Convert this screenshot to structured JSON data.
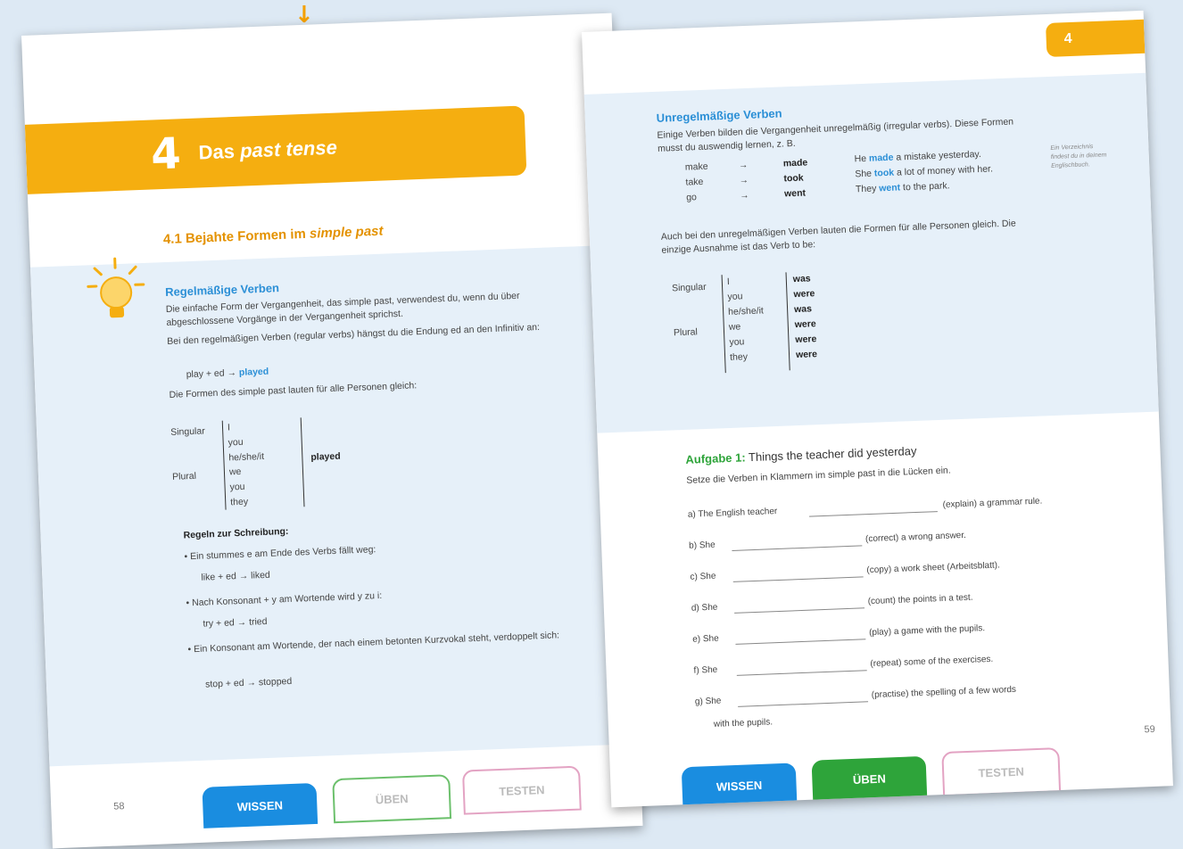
{
  "arrow": "↓",
  "left_page": {
    "chapter_number": "4",
    "chapter_title_pre": "Das ",
    "chapter_title_em": "past tense",
    "section": "4.1 Bejahte Formen im ",
    "section_em": "simple past",
    "sub_heading": "Regelmäßige Verben",
    "para1": "Die einfache Form der Vergangenheit, das simple past, verwendest du, wenn du über abgeschlossene Vorgänge in der Vergangenheit sprichst.",
    "para2": "Bei den regelmäßigen Verben (regular verbs) hängst du die Endung ed an den Infinitiv an:",
    "example1": "play + ed →",
    "example1_result": "played",
    "para3": "Die Formen des simple past lauten für alle Personen gleich:",
    "table": {
      "singular": "Singular",
      "plural": "Plural",
      "pronouns": [
        "I",
        "you",
        "he/she/it",
        "we",
        "you",
        "they"
      ],
      "form": "played"
    },
    "rules_heading": "Regeln zur Schreibung:",
    "rules": [
      {
        "text": "Ein stummes e am Ende des Verbs fällt weg:",
        "example": "like + ed → liked"
      },
      {
        "text": "Nach Konsonant + y am Wortende wird y zu i:",
        "example": "try + ed → tried"
      },
      {
        "text": "Ein Konsonant am Wortende, der nach einem betonten Kurzvokal steht, verdoppelt sich:",
        "example": "stop + ed → stopped"
      }
    ],
    "page_number": "58",
    "tabs": [
      "WISSEN",
      "ÜBEN",
      "TESTEN"
    ]
  },
  "right_page": {
    "corner_number": "4",
    "sub_heading": "Unregelmäßige Verben",
    "para1": "Einige Verben bilden die Vergangenheit unregelmäßig (irregular verbs). Diese Formen musst du auswendig lernen, z. B.",
    "irregular": [
      {
        "inf": "make",
        "past": "made",
        "sentence_pre": "He ",
        "sentence_verb": "made",
        "sentence_post": " a mistake yesterday."
      },
      {
        "inf": "take",
        "past": "took",
        "sentence_pre": "She ",
        "sentence_verb": "took",
        "sentence_post": " a lot of money with her."
      },
      {
        "inf": "go",
        "past": "went",
        "sentence_pre": "They ",
        "sentence_verb": "went",
        "sentence_post": " to the park."
      }
    ],
    "margin_note": "Ein Verzeichnis findest du in deinem Englischbuch.",
    "para2": "Auch bei den unregelmäßigen Verben lauten die Formen für alle Personen gleich. Die einzige Ausnahme ist das Verb to be:",
    "be_table": {
      "singular": "Singular",
      "plural": "Plural",
      "pronouns": [
        "I",
        "you",
        "he/she/it",
        "we",
        "you",
        "they"
      ],
      "forms": [
        "was",
        "were",
        "was",
        "were",
        "were",
        "were"
      ]
    },
    "task_label": "Aufgabe 1:",
    "task_title": " Things the teacher did yesterday",
    "task_instruction": "Setze die Verben in Klammern im simple past in die Lücken ein.",
    "exercises": [
      {
        "label": "a)",
        "subject": "The English teacher",
        "hint": "(explain) a grammar rule."
      },
      {
        "label": "b)",
        "subject": "She",
        "hint": "(correct) a wrong answer."
      },
      {
        "label": "c)",
        "subject": "She",
        "hint": "(copy) a work sheet (Arbeitsblatt)."
      },
      {
        "label": "d)",
        "subject": "She",
        "hint": "(count) the points in a test."
      },
      {
        "label": "e)",
        "subject": "She",
        "hint": "(play) a game with the pupils."
      },
      {
        "label": "f)",
        "subject": "She",
        "hint": "(repeat) some of the exercises."
      },
      {
        "label": "g)",
        "subject": "She",
        "hint": "(practise) the spelling of a few words"
      }
    ],
    "exercise_tail": "with the pupils.",
    "page_number": "59",
    "tabs": [
      "WISSEN",
      "ÜBEN",
      "TESTEN"
    ]
  }
}
